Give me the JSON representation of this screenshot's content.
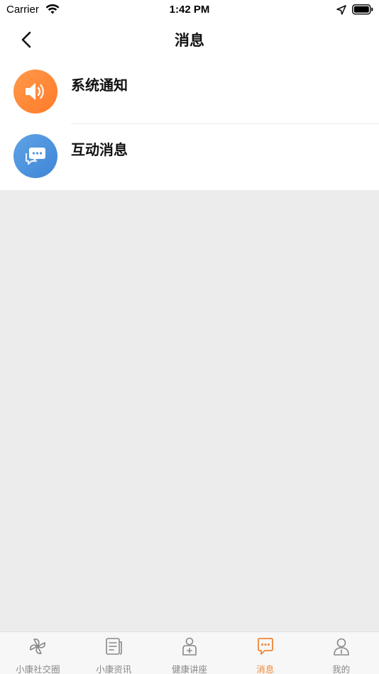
{
  "status_bar": {
    "carrier": "Carrier",
    "time": "1:42 PM"
  },
  "nav": {
    "title": "消息"
  },
  "messages": [
    {
      "label": "系统通知",
      "icon": "speaker-icon",
      "color": "#ff8a3a"
    },
    {
      "label": "互动消息",
      "icon": "chat-bubble-icon",
      "color": "#4a90dc"
    }
  ],
  "tabs": [
    {
      "label": "小康社交圈",
      "icon": "pinwheel-icon",
      "active": false
    },
    {
      "label": "小康资讯",
      "icon": "news-icon",
      "active": false
    },
    {
      "label": "健康讲座",
      "icon": "doctor-icon",
      "active": false
    },
    {
      "label": "消息",
      "icon": "message-icon",
      "active": true
    },
    {
      "label": "我的",
      "icon": "profile-icon",
      "active": false
    }
  ],
  "colors": {
    "accent": "#f08535",
    "tab_inactive": "#888888",
    "background": "#ececec"
  }
}
